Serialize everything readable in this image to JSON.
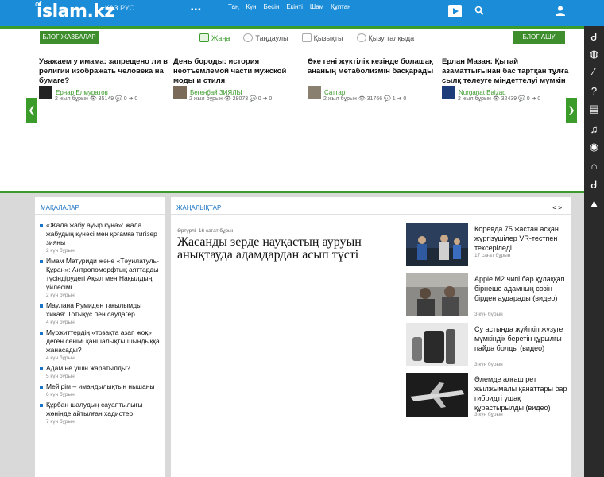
{
  "header": {
    "logo_text": "islam.kz",
    "logo_prefix": "of",
    "lang_kz": "ҚАЗ",
    "lang_ru": "РУС",
    "dots": "▪▪▪",
    "prayer_times": [
      "Таң",
      "Күн",
      "Бесін",
      "Екінті",
      "Шам",
      "Құптан"
    ]
  },
  "blog": {
    "tag_label": "БЛОГ ЖАЗБАЛАР",
    "tabs": [
      {
        "label": "Жаңа",
        "active": true
      },
      {
        "label": "Таңдаулы",
        "active": false
      },
      {
        "label": "Қызықты",
        "active": false
      },
      {
        "label": "Қызу талқыда",
        "active": false
      }
    ],
    "open_label": "БЛОГ АШУ",
    "prev_arrow": "❮",
    "next_arrow": "❯",
    "cards": [
      {
        "title": "Уважаем у имама: запрещено ли в религии изображать человека на бумаге?",
        "author": "Ернар Елмуратов",
        "meta": "2 жыл бұрын 👁 35149 💬 0 ➜ 0"
      },
      {
        "title": "День бороды: история неотъемлемой части мужской моды и стиля",
        "author": "Бегенбай ЗИЯЛЫ",
        "meta": "2 жыл бұрын 👁 28073 💬 0 ➜ 0"
      },
      {
        "title": "Әке гені жүктілік кезінде болашақ ананың метаболизмін басқарады",
        "author": "Саттар",
        "meta": "2 жыл бұрын 👁 31766 💬 1 ➜ 0"
      },
      {
        "title": "Ерлан Мазан: Қытай азаматтығынан бас тартқан тұлға сылқ төлеуге міндеттелуі мүмкін",
        "author": "Nurganat Baizaq",
        "meta": "2 жыл бұрын 👁 32439 💬 0 ➜ 0"
      }
    ]
  },
  "articles": {
    "heading": "МАҚАЛАЛАР",
    "items": [
      {
        "title": "«Жала жабу ауыр күнә»: жала жабудың күнәсі мен қоғамға тигізер зияны",
        "ago": "2 күн бұрын"
      },
      {
        "title": "Имам Матуриди және «Тәуилатуль-Құран»: Антропоморфтық аяттарды түсіндірудегі Ақыл мен Нақылдың үйлесімі",
        "ago": "2 күн бұрын"
      },
      {
        "title": "Маулана Румиден тағылымды хикая: Тотықұс пен саудагер",
        "ago": "4 күн бұрын"
      },
      {
        "title": "Мүржиттердің «тозақта азап жоқ» деген сенімі қаншалықты шындыққа жанасады?",
        "ago": "4 күн бұрын"
      },
      {
        "title": "Адам не үшін жаратылды?",
        "ago": "5 күн бұрын"
      },
      {
        "title": "Мейірім – имандылықтың нышаны",
        "ago": "6 күн бұрын"
      },
      {
        "title": "Құрбан шалудың сауаптылығы жөнінде айтылған хадистер",
        "ago": "7 күн бұрын"
      }
    ]
  },
  "news": {
    "heading": "ЖАҢАЛЫҚТАР",
    "nav": "< >",
    "main": {
      "category": "Әртүрлі",
      "ago": "16 сағат бұрын",
      "title": "Жасанды зерде науқастың ауруын анықтауда адамдардан асып түсті"
    },
    "side": [
      {
        "title": "Кореяда 75 жастан асқан жүргізушілер VR-тестпен тексеріледі",
        "ago": "17 сағат бұрын"
      },
      {
        "title": "Apple M2 чипі бар құлаққап бірнеше адамның сөзін бірден аударады (видео)",
        "ago": "3 күн бұрын"
      },
      {
        "title": "Су астында жүйткіп жүзуге мүмкіндік беретін құрылғы пайда болды (видео)",
        "ago": "3 күн бұрын"
      },
      {
        "title": "Әлемде алғаш рет жылжымалы қанаттары бар гибридті ұшақ құрастырылды (видео)",
        "ago": "3 күн бұрын"
      }
    ]
  },
  "rightbar_icons": [
    "of-icon",
    "globe-icon",
    "quill-icon",
    "question-icon",
    "book-icon",
    "music-icon",
    "radio-icon",
    "mosque-icon",
    "of-icon-2",
    "flag-icon"
  ]
}
